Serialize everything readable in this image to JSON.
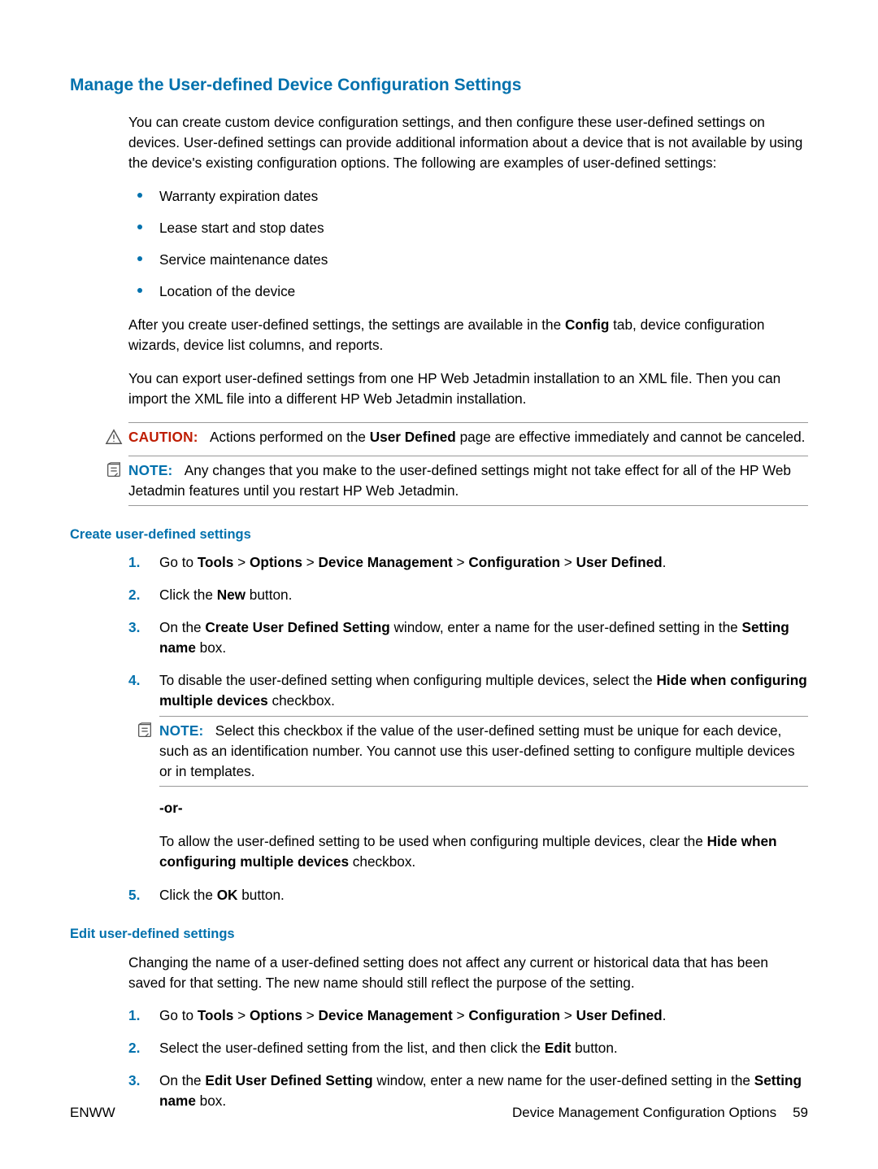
{
  "heading": "Manage the User-defined Device Configuration Settings",
  "intro": "You can create custom device configuration settings, and then configure these user-defined settings on devices. User-defined settings can provide additional information about a device that is not available by using the device's existing configuration options. The following are examples of user-defined settings:",
  "bullets": [
    "Warranty expiration dates",
    "Lease start and stop dates",
    "Service maintenance dates",
    "Location of the device"
  ],
  "after_bullets_1_pre": "After you create user-defined settings, the settings are available in the ",
  "after_bullets_1_bold": "Config",
  "after_bullets_1_post": " tab, device configuration wizards, device list columns, and reports.",
  "after_bullets_2": "You can export user-defined settings from one HP Web Jetadmin installation to an XML file. Then you can import the XML file into a different HP Web Jetadmin installation.",
  "caution": {
    "label": "CAUTION:",
    "pre": "Actions performed on the ",
    "bold": "User Defined",
    "post": " page are effective immediately and cannot be canceled."
  },
  "note1": {
    "label": "NOTE:",
    "text": "Any changes that you make to the user-defined settings might not take effect for all of the HP Web Jetadmin features until you restart HP Web Jetadmin."
  },
  "section_create": {
    "title": "Create user-defined settings",
    "steps": {
      "s1": {
        "t1": "Go to ",
        "b1": "Tools",
        "gt1": " > ",
        "b2": "Options",
        "gt2": " > ",
        "b3": "Device Management",
        "gt3": " > ",
        "b4": "Configuration",
        "gt4": " > ",
        "b5": "User Defined",
        "end": "."
      },
      "s2": {
        "t1": "Click the ",
        "b1": "New",
        "t2": " button."
      },
      "s3": {
        "t1": "On the ",
        "b1": "Create User Defined Setting",
        "t2": " window, enter a name for the user-defined setting in the ",
        "b2": "Setting name",
        "t3": " box."
      },
      "s4": {
        "t1": "To disable the user-defined setting when configuring multiple devices, select the ",
        "b1": "Hide when configuring multiple devices",
        "t2": " checkbox.",
        "note": {
          "label": "NOTE:",
          "text": "Select this checkbox if the value of the user-defined setting must be unique for each device, such as an identification number. You cannot use this user-defined setting to configure multiple devices or in templates."
        },
        "or": "-or-",
        "alt_t1": "To allow the user-defined setting to be used when configuring multiple devices, clear the ",
        "alt_b1": "Hide when configuring multiple devices",
        "alt_t2": " checkbox."
      },
      "s5": {
        "t1": "Click the ",
        "b1": "OK",
        "t2": " button."
      }
    }
  },
  "section_edit": {
    "title": "Edit user-defined settings",
    "intro": "Changing the name of a user-defined setting does not affect any current or historical data that has been saved for that setting. The new name should still reflect the purpose of the setting.",
    "steps": {
      "s1": {
        "t1": "Go to ",
        "b1": "Tools",
        "gt1": " > ",
        "b2": "Options",
        "gt2": " > ",
        "b3": "Device Management",
        "gt3": " > ",
        "b4": "Configuration",
        "gt4": " > ",
        "b5": "User Defined",
        "end": "."
      },
      "s2": {
        "t1": "Select the user-defined setting from the list, and then click the ",
        "b1": "Edit",
        "t2": " button."
      },
      "s3": {
        "t1": "On the ",
        "b1": "Edit User Defined Setting",
        "t2": " window, enter a new name for the user-defined setting in the ",
        "b2": "Setting name",
        "t3": " box."
      }
    }
  },
  "footer": {
    "left": "ENWW",
    "right_text": "Device Management Configuration Options",
    "page": "59"
  }
}
